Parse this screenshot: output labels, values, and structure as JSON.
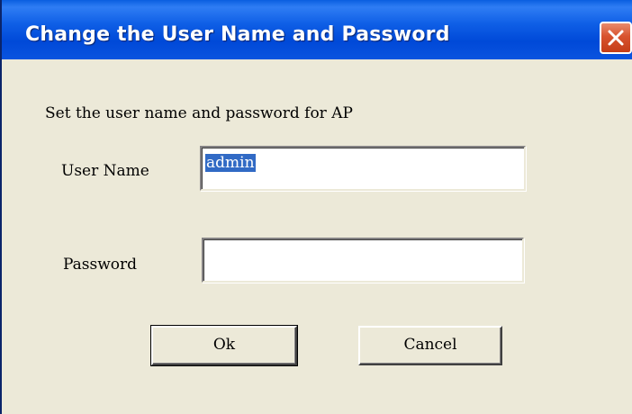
{
  "window": {
    "title": "Change the User Name and Password",
    "close_icon": "close-icon"
  },
  "form": {
    "instruction": "Set the user name and password for  AP",
    "username_label": "User Name",
    "username_value": "admin",
    "password_label": "Password",
    "password_value": ""
  },
  "buttons": {
    "ok_label": "Ok",
    "cancel_label": "Cancel"
  },
  "colors": {
    "titlebar": "#0a5ee0",
    "dialog_bg": "#ece9d8",
    "close_button": "#d8532e",
    "selection": "#316ac5"
  }
}
